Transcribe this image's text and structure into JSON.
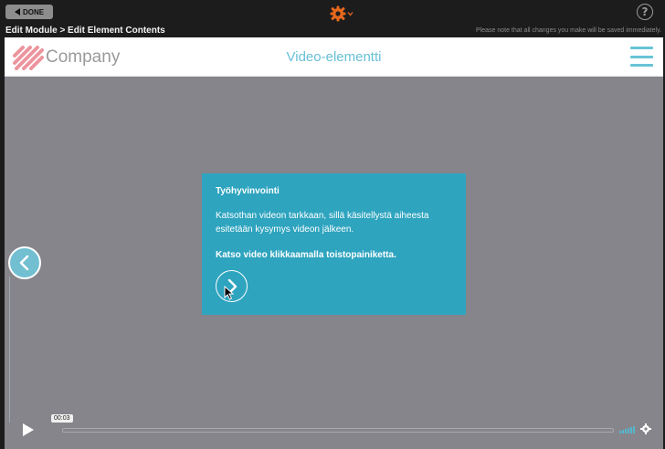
{
  "topbar": {
    "done_label": "DONE",
    "breadcrumb": "Edit Module > Edit Element Contents",
    "notice": "Please note that all changes you make will be saved immediately.",
    "help_label": "?"
  },
  "header": {
    "logo_text": "Company",
    "title": "Video-elementti"
  },
  "card": {
    "title": "Työhyvinvointi",
    "body": "Katsothan videon tarkkaan, sillä käsitellystä aiheesta esitetään kysymys videon jälkeen.",
    "cta": "Katso video klikkaamalla toistopainiketta."
  },
  "player": {
    "time": "00:03",
    "progress": 0.0
  },
  "colors": {
    "accent": "#2ea4bf",
    "header_title": "#67c0d6",
    "gear": "#e5681c",
    "overlay": "#86858b"
  },
  "icons": [
    "back-arrow-icon",
    "gear-icon",
    "help-icon",
    "hamburger-menu-icon",
    "chevron-left-icon",
    "chevron-right-icon",
    "play-icon",
    "volume-icon",
    "settings-icon"
  ]
}
